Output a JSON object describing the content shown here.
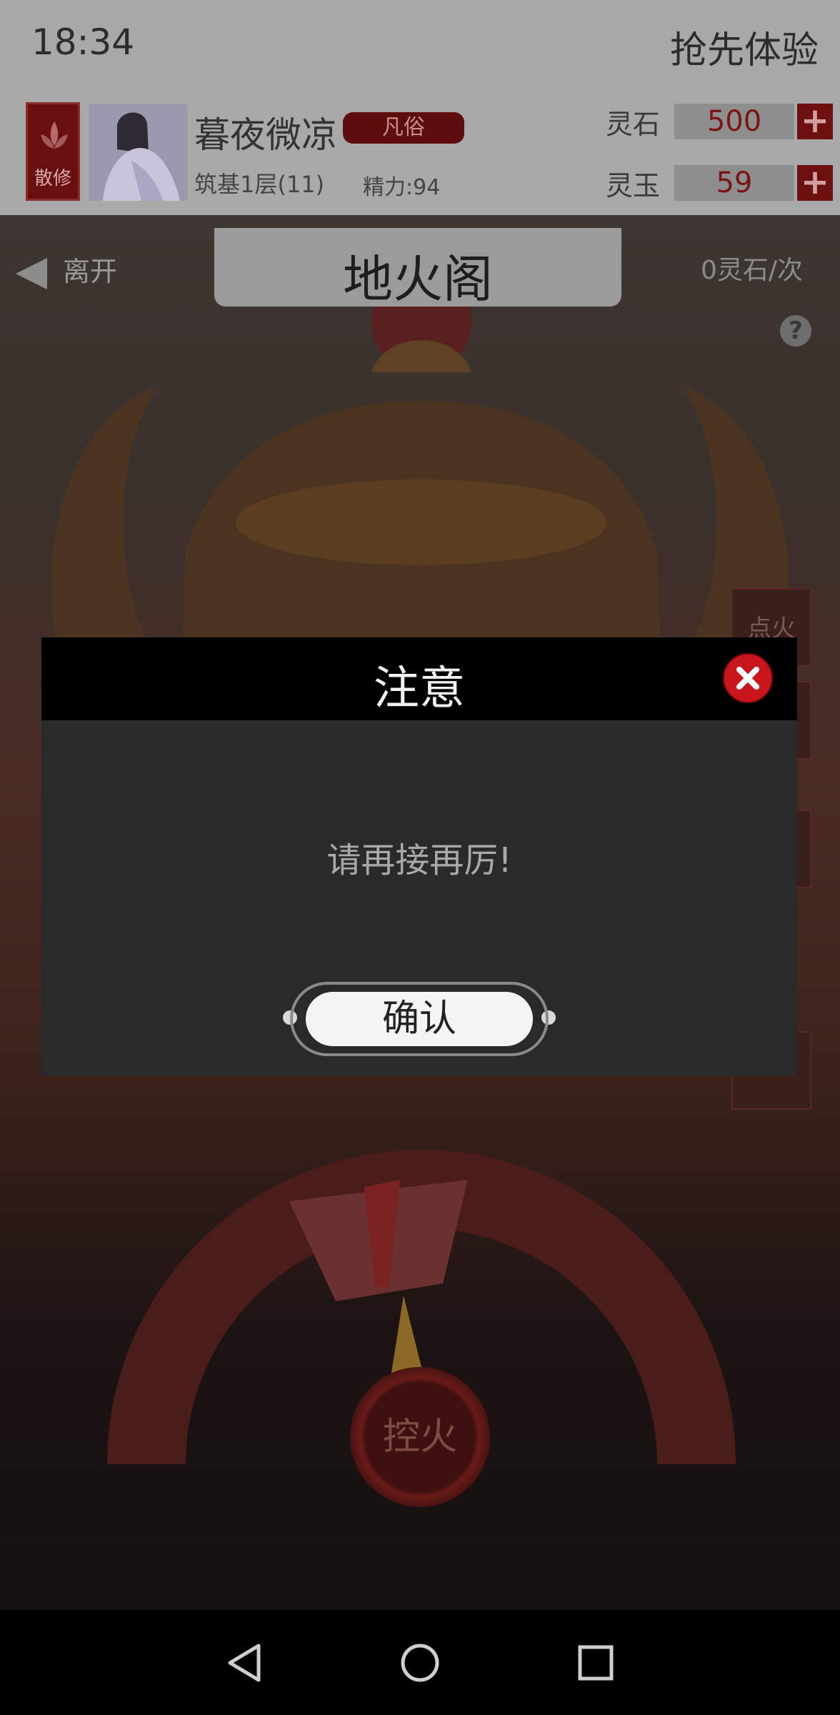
{
  "status_bar": {
    "time": "18:34",
    "promo_text": "抢先体验"
  },
  "player": {
    "sect_badge": "散修",
    "name": "暮夜微凉",
    "rank": "凡俗",
    "realm": "筑基1层(11)",
    "energy": "精力:94"
  },
  "currencies": [
    {
      "label": "灵石",
      "value": "500"
    },
    {
      "label": "灵玉",
      "value": "59"
    }
  ],
  "scene": {
    "title": "地火阁",
    "leave_label": "离开",
    "cost_label": "0灵石/次",
    "side_buttons": [
      "点火",
      "",
      "",
      ""
    ],
    "control_label": "控火"
  },
  "dialog": {
    "title": "注意",
    "message": "请再接再厉!",
    "confirm_label": "确认"
  },
  "icons": {
    "close": "close-icon",
    "help": "help-icon",
    "back": "back-nav-icon",
    "home": "home-nav-icon",
    "recents": "recents-nav-icon"
  },
  "colors": {
    "accent_red": "#c8161c",
    "dialog_bg": "#2a2a2a",
    "header_bg": "#000000"
  }
}
